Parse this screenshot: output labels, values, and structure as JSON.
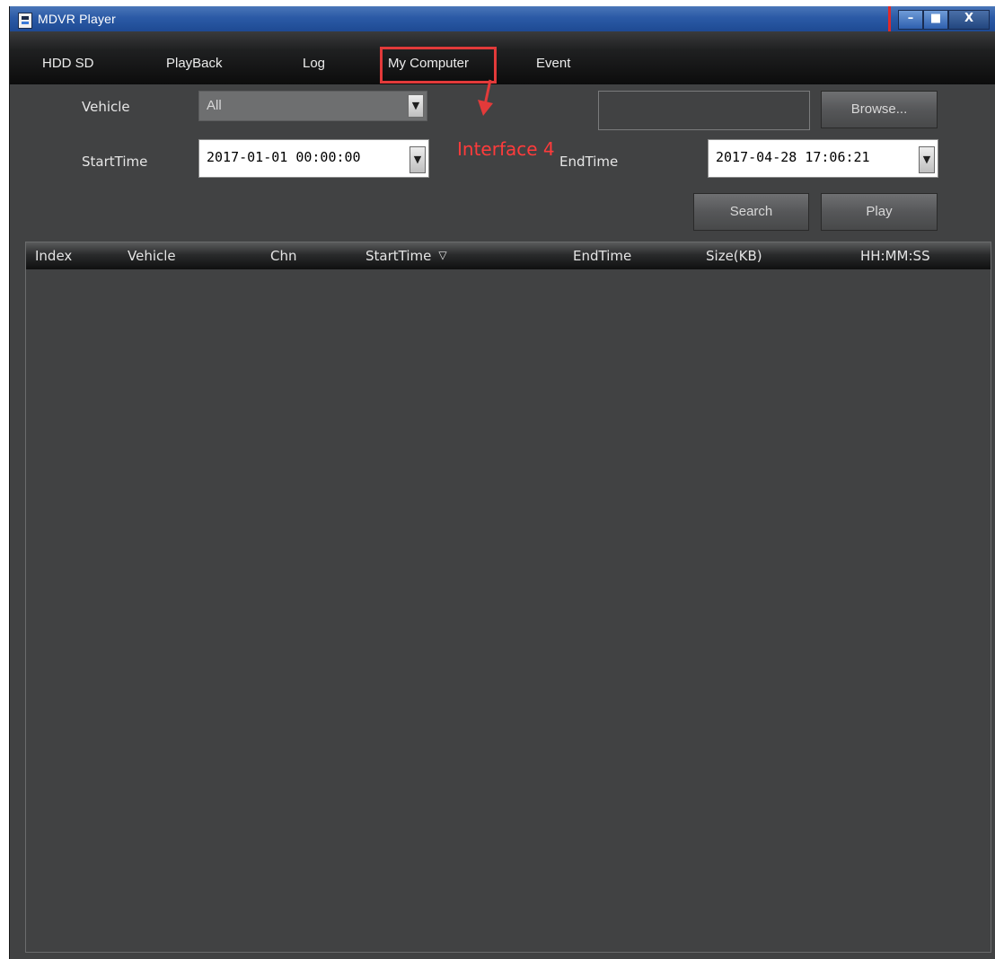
{
  "window": {
    "title": "MDVR Player",
    "controls": {
      "minimize": "–",
      "maximize": "■",
      "close": "X"
    }
  },
  "menu": {
    "items": [
      "HDD SD",
      "PlayBack",
      "Log",
      "My Computer",
      "Event"
    ],
    "highlighted": "My Computer"
  },
  "annotation": {
    "label": "Interface 4"
  },
  "form": {
    "vehicle_label": "Vehicle",
    "vehicle_value": "All",
    "start_label": "StartTime",
    "start_value": "2017-01-01 00:00:00",
    "end_label": "EndTime",
    "end_value": "2017-04-28 17:06:21",
    "path_value": "",
    "browse_label": "Browse...",
    "search_label": "Search",
    "play_label": "Play"
  },
  "table": {
    "columns": [
      "Index",
      "Vehicle",
      "Chn",
      "StartTime",
      "EndTime",
      "Size(KB)",
      "HH:MM:SS"
    ],
    "sort_icon": "▽",
    "rows": []
  },
  "colors": {
    "annotation": "#e23a3a",
    "background": "#414243"
  }
}
